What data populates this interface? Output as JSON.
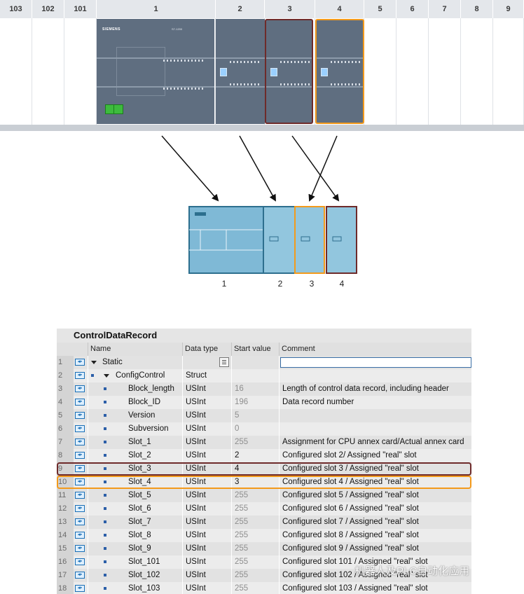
{
  "rack": {
    "slot_numbers": [
      "103",
      "102",
      "101",
      "1",
      "2",
      "3",
      "4",
      "5",
      "6",
      "7",
      "8",
      "9"
    ],
    "brand": "SIEMENS",
    "cpu_model_text": "S7-1200",
    "colors": {
      "module": "#5f6e80",
      "highlight_slot3": "#6e2a2a",
      "highlight_slot4": "#f39a1b",
      "ethernet": "#3dbb3d"
    }
  },
  "diagram": {
    "labels": [
      "1",
      "2",
      "3",
      "4"
    ]
  },
  "table": {
    "title": "ControlDataRecord",
    "columns": [
      "Name",
      "Data type",
      "Start value",
      "Comment"
    ],
    "rows": [
      {
        "num": "1",
        "name": "Static",
        "type": "",
        "start": "",
        "comment": "",
        "level": 0,
        "expander": true
      },
      {
        "num": "2",
        "name": "ConfigControl",
        "type": "Struct",
        "start": "",
        "comment": "",
        "level": 1,
        "expander": true
      },
      {
        "num": "3",
        "name": "Block_length",
        "type": "USInt",
        "start": "16",
        "comment": "Length of control data record, including header",
        "level": 2,
        "faded": true
      },
      {
        "num": "4",
        "name": "Block_ID",
        "type": "USInt",
        "start": "196",
        "comment": "Data record number",
        "level": 2,
        "faded": true
      },
      {
        "num": "5",
        "name": "Version",
        "type": "USInt",
        "start": "5",
        "comment": "",
        "level": 2,
        "faded": true
      },
      {
        "num": "6",
        "name": "Subversion",
        "type": "USInt",
        "start": "0",
        "comment": "",
        "level": 2,
        "faded": true
      },
      {
        "num": "7",
        "name": "Slot_1",
        "type": "USInt",
        "start": "255",
        "comment": "Assignment for CPU annex card/Actual annex card",
        "level": 2,
        "faded": true
      },
      {
        "num": "8",
        "name": "Slot_2",
        "type": "USInt",
        "start": "2",
        "comment": "Configured slot 2/ Assigned \"real\" slot",
        "level": 2,
        "faded": false
      },
      {
        "num": "9",
        "name": "Slot_3",
        "type": "USInt",
        "start": "4",
        "comment": "Configured slot 3 / Assigned \"real\" slot",
        "level": 2,
        "faded": false
      },
      {
        "num": "10",
        "name": "Slot_4",
        "type": "USInt",
        "start": "3",
        "comment": "Configured slot 4 / Assigned \"real\" slot",
        "level": 2,
        "faded": false
      },
      {
        "num": "11",
        "name": "Slot_5",
        "type": "USInt",
        "start": "255",
        "comment": "Configured slot 5 / Assigned \"real\" slot",
        "level": 2,
        "faded": true
      },
      {
        "num": "12",
        "name": "Slot_6",
        "type": "USInt",
        "start": "255",
        "comment": "Configured slot 6 / Assigned \"real\" slot",
        "level": 2,
        "faded": true
      },
      {
        "num": "13",
        "name": "Slot_7",
        "type": "USInt",
        "start": "255",
        "comment": "Configured slot 7 / Assigned \"real\" slot",
        "level": 2,
        "faded": true
      },
      {
        "num": "14",
        "name": "Slot_8",
        "type": "USInt",
        "start": "255",
        "comment": "Configured slot 8 / Assigned \"real\" slot",
        "level": 2,
        "faded": true
      },
      {
        "num": "15",
        "name": "Slot_9",
        "type": "USInt",
        "start": "255",
        "comment": "Configured slot 9 / Assigned \"real\" slot",
        "level": 2,
        "faded": true
      },
      {
        "num": "16",
        "name": "Slot_101",
        "type": "USInt",
        "start": "255",
        "comment": "Configured slot 101 / Assigned \"real\" slot",
        "level": 2,
        "faded": true
      },
      {
        "num": "17",
        "name": "Slot_102",
        "type": "USInt",
        "start": "255",
        "comment": "Configured slot 102 / Assigned \"real\" slot",
        "level": 2,
        "faded": true
      },
      {
        "num": "18",
        "name": "Slot_103",
        "type": "USInt",
        "start": "255",
        "comment": "Configured slot 103 / Assigned \"real\" slot",
        "level": 2,
        "faded": true
      }
    ]
  },
  "watermark": "机器人及PLC自动化应用"
}
